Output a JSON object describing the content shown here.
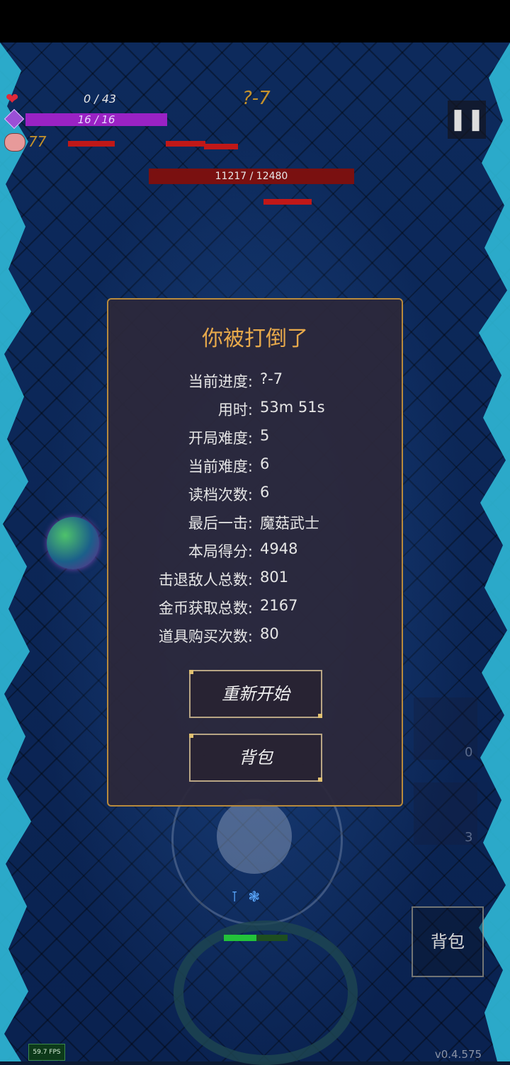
{
  "hud": {
    "hp_text": "0 / 43",
    "mana_text": "16 / 16",
    "coins_text": "77",
    "stage_label": "?-7",
    "pause_icon": "pause-icon",
    "boss_hp_text": "11217 / 12480"
  },
  "dialog": {
    "title": "你被打倒了",
    "stats": [
      {
        "label": "当前进度:",
        "value": "?-7"
      },
      {
        "label": "用时:",
        "value": "53m 51s"
      },
      {
        "label": "开局难度:",
        "value": "5"
      },
      {
        "label": "当前难度:",
        "value": "6"
      },
      {
        "label": "读档次数:",
        "value": "6"
      },
      {
        "label": "最后一击:",
        "value": "魔菇武士"
      },
      {
        "label": "本局得分:",
        "value": "4948"
      },
      {
        "label": "击退敌人总数:",
        "value": "801"
      },
      {
        "label": "金币获取总数:",
        "value": "2167"
      },
      {
        "label": "道具购买次数:",
        "value": "80"
      }
    ],
    "restart_label": "重新开始",
    "backpack_label": "背包"
  },
  "side": {
    "item_count_1": "0",
    "item_count_2": "3",
    "backpack_label": "背包"
  },
  "footer": {
    "fps": "59.7 FPS",
    "version": "v0.4.575"
  },
  "colors": {
    "title": "#e7a94b",
    "stage": "#c5922b",
    "mana": "#9a22c4",
    "dialog_border": "#b88a3c"
  }
}
